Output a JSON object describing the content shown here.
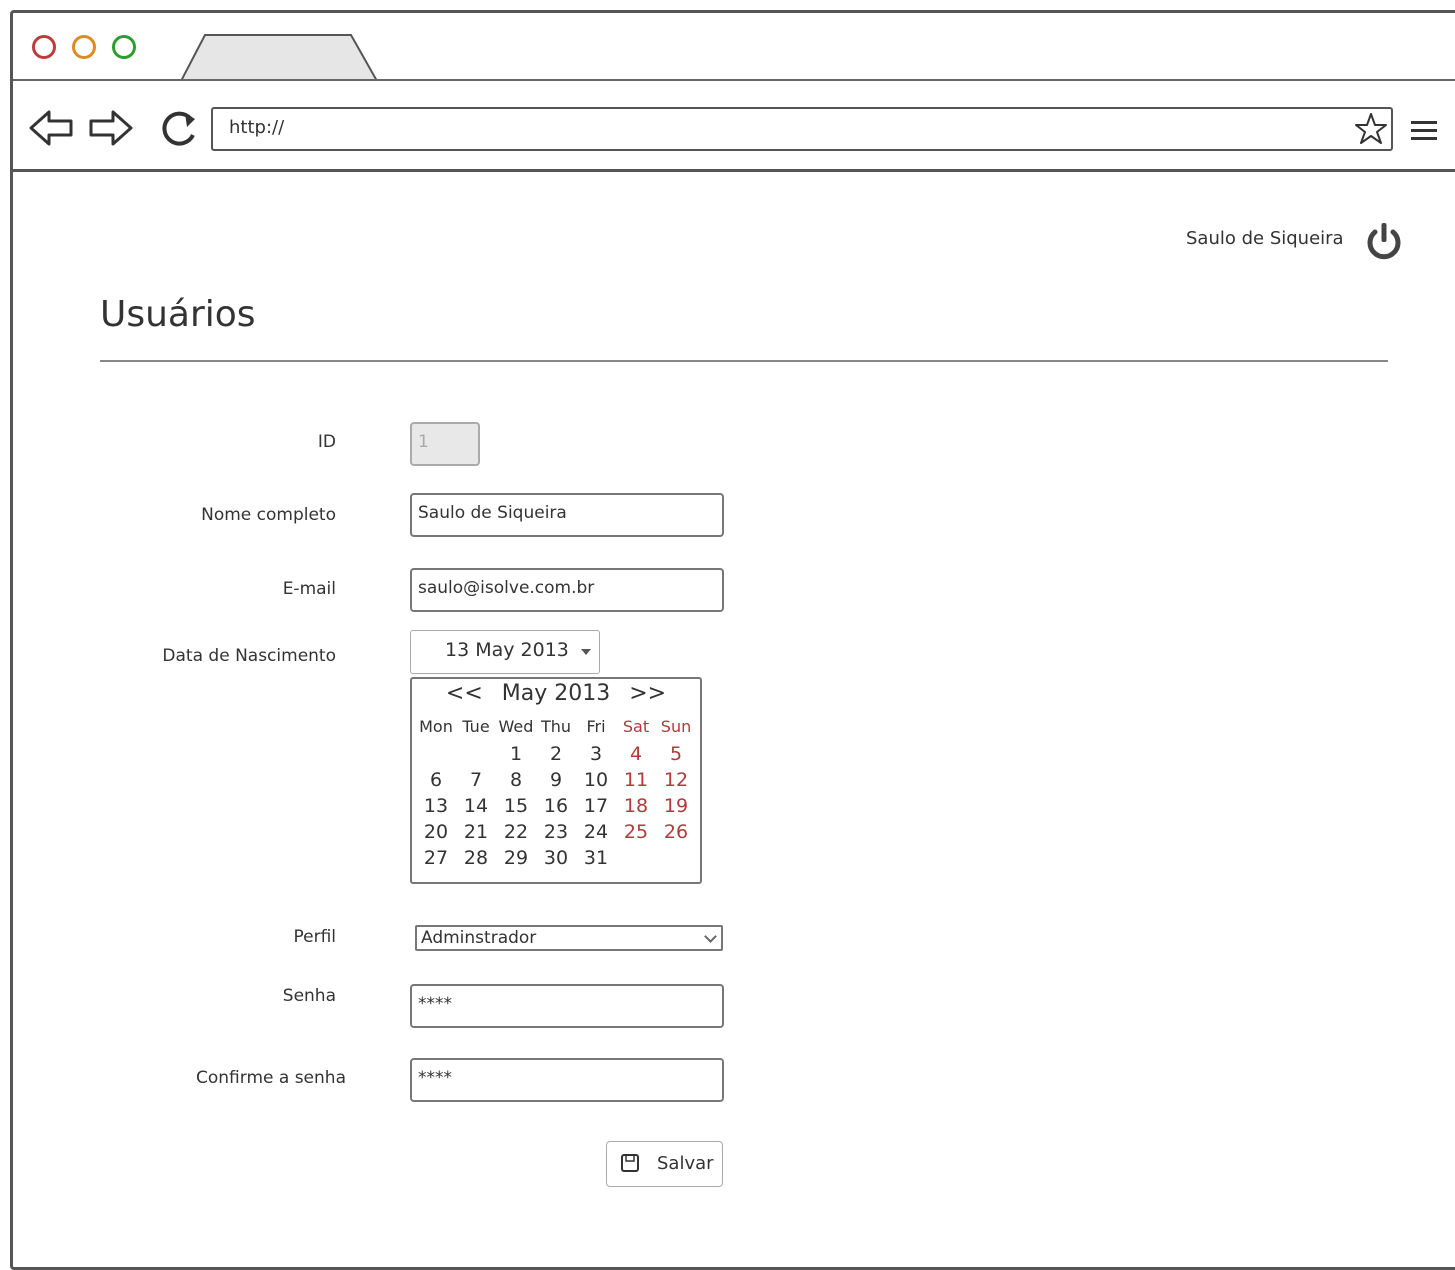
{
  "browser": {
    "url": "http://"
  },
  "header": {
    "user_name": "Saulo de Siqueira"
  },
  "page": {
    "title": "Usuários"
  },
  "form": {
    "id_label": "ID",
    "id_value": "1",
    "name_label": "Nome completo",
    "name_value": "Saulo de Siqueira",
    "email_label": "E-mail",
    "email_value": "saulo@isolve.com.br",
    "birth_label": "Data de Nascimento",
    "birth_value": "13 May 2013",
    "profile_label": "Perfil",
    "profile_value": "Adminstrador",
    "password_label": "Senha",
    "password_value": "****",
    "confirm_label": "Confirme a senha",
    "confirm_value": "****",
    "save_label": "Salvar"
  },
  "calendar": {
    "prev": "<<",
    "month": "May 2013",
    "next": ">>",
    "weekdays": [
      "Mon",
      "Tue",
      "Wed",
      "Thu",
      "Fri",
      "Sat",
      "Sun"
    ],
    "days": [
      "",
      "",
      "1",
      "2",
      "3",
      "4",
      "5",
      "6",
      "7",
      "8",
      "9",
      "10",
      "11",
      "12",
      "13",
      "14",
      "15",
      "16",
      "17",
      "18",
      "19",
      "20",
      "21",
      "22",
      "23",
      "24",
      "25",
      "26",
      "27",
      "28",
      "29",
      "30",
      "31",
      "",
      ""
    ],
    "weekend_color": "#b03a3a"
  },
  "icons": {
    "back": "back-arrow-icon",
    "forward": "forward-arrow-icon",
    "reload": "reload-icon",
    "star": "star-icon",
    "menu": "menu-icon",
    "power": "power-icon",
    "save": "floppy-disk-icon"
  }
}
